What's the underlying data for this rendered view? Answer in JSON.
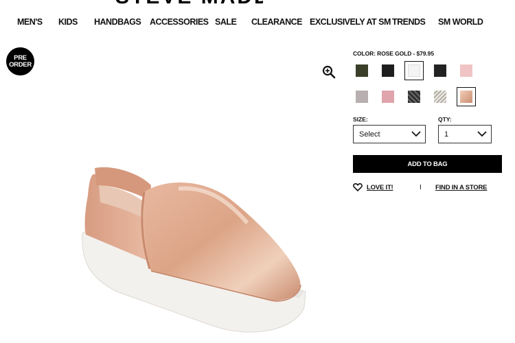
{
  "brand": {
    "logo_text": "STEVE MADDEN"
  },
  "nav": {
    "items": [
      "MEN'S",
      "KIDS",
      "HANDBAGS",
      "ACCESSORIES",
      "SALE",
      "CLEARANCE",
      "EXCLUSIVELY AT SM",
      "TRENDS",
      "SM WORLD"
    ]
  },
  "badge": {
    "line1": "PRE",
    "line2": "ORDER"
  },
  "product": {
    "color_label": "COLOR: ROSE GOLD - $79.95",
    "selected_color": "ROSE GOLD",
    "price": "$79.95",
    "swatches": [
      {
        "name": "olive-camo",
        "color": "#3a3f2a",
        "selected": false
      },
      {
        "name": "black",
        "color": "#1e1e1e",
        "selected": false
      },
      {
        "name": "white",
        "color": "#f4f4f4",
        "selected": false
      },
      {
        "name": "black-2",
        "color": "#222222",
        "selected": false
      },
      {
        "name": "blush",
        "color": "#f0c4c4",
        "selected": false
      },
      {
        "name": "grey",
        "color": "#b8b0b0",
        "selected": false
      },
      {
        "name": "pink-glitter",
        "color": "#dfa4ac",
        "selected": false
      },
      {
        "name": "black-glitter",
        "color": "#4a4a4a",
        "selected": false
      },
      {
        "name": "snake",
        "color": "#c9c6bd",
        "selected": false
      },
      {
        "name": "rose-gold",
        "color": "#dba98e",
        "selected": true
      }
    ],
    "size": {
      "label": "SIZE:",
      "value": "Select"
    },
    "qty": {
      "label": "QTY:",
      "value": "1"
    },
    "add_to_bag": "ADD TO BAG",
    "love_label": "LOVE IT!",
    "divider": "I",
    "find_in_store": "FIND IN A STORE"
  },
  "icons": {
    "zoom": "zoom-in-icon",
    "heart": "heart-outline-icon",
    "chevron": "chevron-down-icon"
  }
}
